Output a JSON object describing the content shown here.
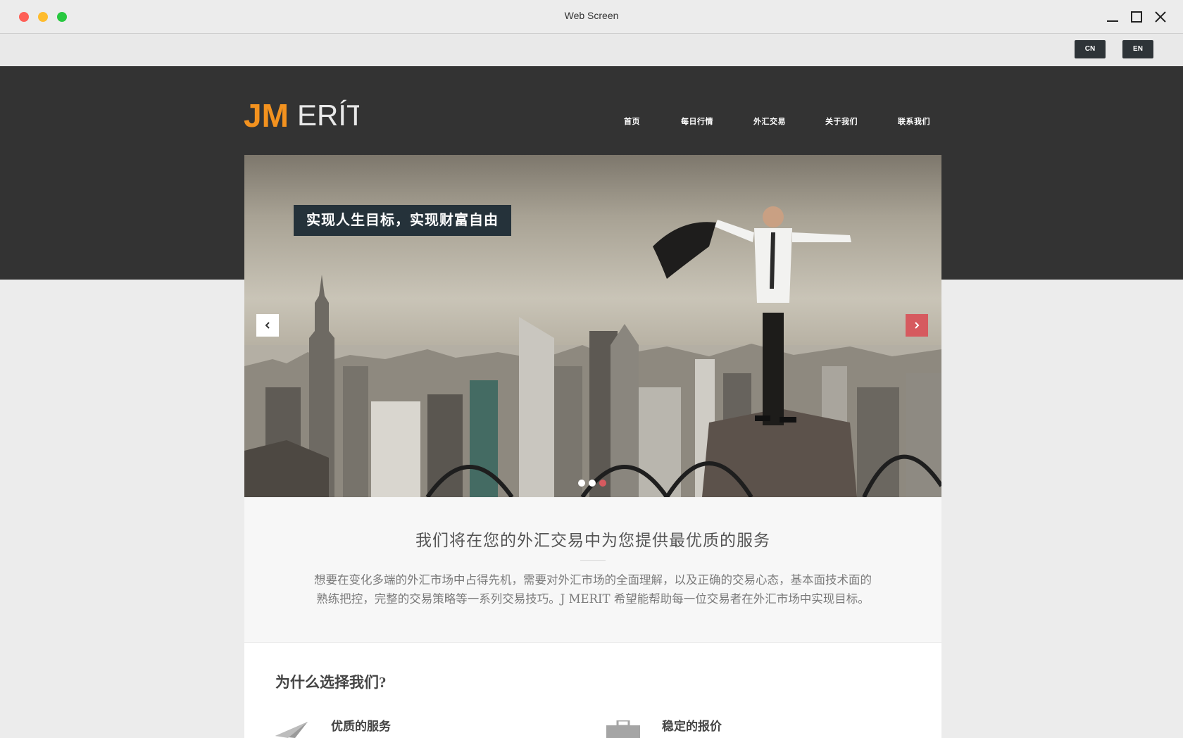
{
  "window": {
    "title": "Web Screen"
  },
  "lang": {
    "cn": "CN",
    "en": "EN"
  },
  "logo": {
    "text_jm": "JM",
    "text_erit": "ERÍT",
    "colors": {
      "jm": "#f3921f",
      "erit": "#ffffff"
    }
  },
  "nav": {
    "items": [
      "首页",
      "每日行情",
      "外汇交易",
      "关于我们",
      "联系我们"
    ]
  },
  "hero": {
    "caption": "实现人生目标，实现财富自由",
    "prev_icon": "chevron-left-icon",
    "next_icon": "chevron-right-icon",
    "slide_count": 3,
    "active_slide": 3
  },
  "intro": {
    "title": "我们将在您的外汇交易中为您提供最优质的服务",
    "text_line1": "想要在变化多端的外汇市场中占得先机，需要对外汇市场的全面理解，以及正确的交易心态，基本面技术面的",
    "text_line2": "熟练把控，完整的交易策略等一系列交易技巧。J MERIT 希望能帮助每一位交易者在外汇市场中实现目标。"
  },
  "why": {
    "title": "为什么选择我们?",
    "features": [
      {
        "title": "优质的服务",
        "icon": "paper-plane-icon"
      },
      {
        "title": "稳定的报价",
        "icon": "briefcase-icon"
      }
    ]
  },
  "colors": {
    "accent": "#d65a5f",
    "header_bg": "#333333",
    "lang_btn": "#2e3438",
    "brand_orange": "#f3921f"
  }
}
